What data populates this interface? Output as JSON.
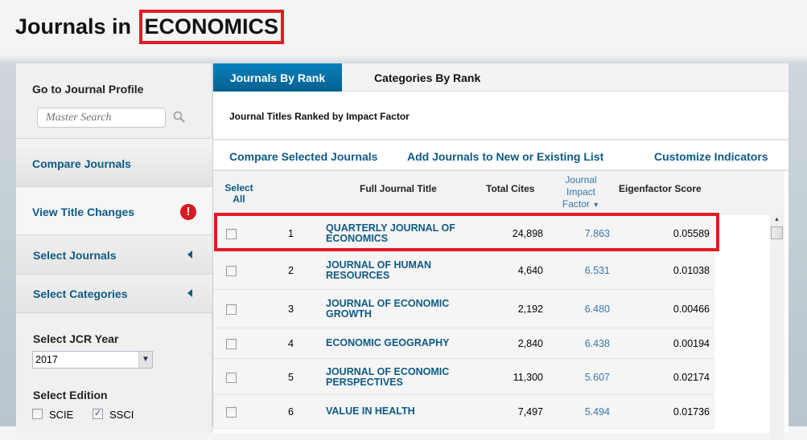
{
  "page_title": {
    "prefix": "Journals in",
    "category": "ECONOMICS"
  },
  "sidebar": {
    "goto_label": "Go to Journal Profile",
    "search_placeholder": "Master Search",
    "compare": "Compare Journals",
    "title_changes": "View Title Changes",
    "select_journals": "Select Journals",
    "select_categories": "Select Categories",
    "year_label": "Select JCR Year",
    "year_value": "2017",
    "edition_label": "Select Edition",
    "editions": [
      {
        "label": "SCIE",
        "checked": false
      },
      {
        "label": "SSCI",
        "checked": true
      }
    ]
  },
  "tabs": [
    "Journals By Rank",
    "Categories By Rank"
  ],
  "subtitle": "Journal Titles Ranked by Impact Factor",
  "actions": [
    "Compare Selected Journals",
    "Add Journals to New or Existing List",
    "Customize Indicators"
  ],
  "columns": {
    "select": "Select All",
    "title": "Full Journal Title",
    "cites": "Total Cites",
    "jif": "Journal Impact Factor",
    "eigen": "Eigenfactor Score"
  },
  "rows": [
    {
      "rank": "1",
      "title": "QUARTERLY JOURNAL OF ECONOMICS",
      "cites": "24,898",
      "jif": "7.863",
      "eigen": "0.05589"
    },
    {
      "rank": "2",
      "title": "JOURNAL OF HUMAN RESOURCES",
      "cites": "4,640",
      "jif": "6.531",
      "eigen": "0.01038"
    },
    {
      "rank": "3",
      "title": "JOURNAL OF ECONOMIC GROWTH",
      "cites": "2,192",
      "jif": "6.480",
      "eigen": "0.00466"
    },
    {
      "rank": "4",
      "title": "ECONOMIC GEOGRAPHY",
      "cites": "2,840",
      "jif": "6.438",
      "eigen": "0.00194"
    },
    {
      "rank": "5",
      "title": "JOURNAL OF ECONOMIC PERSPECTIVES",
      "cites": "11,300",
      "jif": "5.607",
      "eigen": "0.02174"
    },
    {
      "rank": "6",
      "title": "VALUE IN HEALTH",
      "cites": "7,497",
      "jif": "5.494",
      "eigen": "0.01736"
    }
  ],
  "colors": {
    "accent": "#0e5a84",
    "tab_active": "#0a73ab",
    "highlight": "#e31b23"
  }
}
